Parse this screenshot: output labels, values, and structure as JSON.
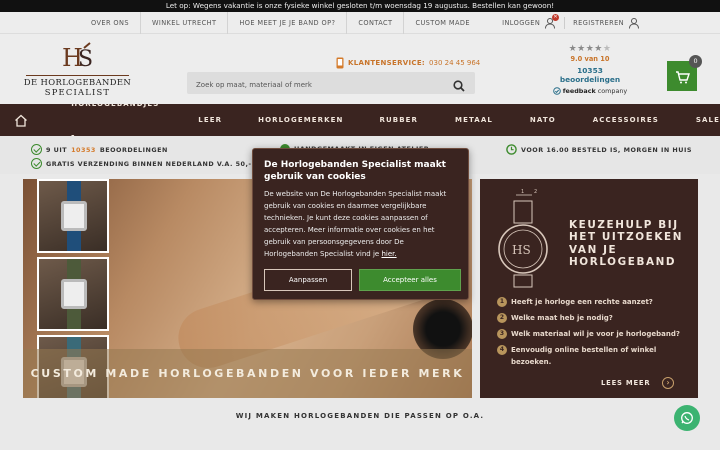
{
  "announcement": "Let op: Wegens vakantie is onze fysieke winkel gesloten t/m woensdag 19 augustus. Bestellen kan gewoon!",
  "topnav": [
    "OVER ONS",
    "WINKEL UTRECHT",
    "HOE MEET JE JE BAND OP?",
    "CONTACT",
    "CUSTOM MADE"
  ],
  "account": {
    "login": "INLOGGEN",
    "register": "REGISTREREN"
  },
  "logo": {
    "line1": "DE HORLOGEBANDEN",
    "line2": "SPECIALIST"
  },
  "search": {
    "placeholder": "Zoek op maat, materiaal of merk"
  },
  "service": {
    "label": "KLANTENSERVICE:",
    "phone": "030 24 45 964"
  },
  "reviews": {
    "stars": 4.5,
    "score": "9.0 van 10",
    "count": "10353 beoordelingen",
    "source_prefix": "feedback",
    "source_suffix": "company"
  },
  "cart": {
    "count": "0"
  },
  "mainnav": [
    "HORLOGEBANDJES",
    "LEER",
    "HORLOGEMERKEN",
    "RUBBER",
    "METAAL",
    "NATO",
    "ACCESSOIRES",
    "SALE"
  ],
  "usps": {
    "rating_prefix": "9 UIT",
    "rating_count": "10353",
    "rating_suffix": "BEOORDELINGEN",
    "shipping": "GRATIS VERZENDING BINNEN NEDERLAND V.A. 50,-",
    "middle": "HANDGEMAAKT IN EIGEN ATELIER",
    "delivery": "VOOR 16.00 BESTELD IS, MORGEN IN HUIS"
  },
  "hero": {
    "caption": "CUSTOM MADE HORLOGEBANDEN VOOR IEDER MERK"
  },
  "helper": {
    "title": "KEUZEHULP BIJ HET UITZOEKEN VAN JE HORLOGEBAND",
    "steps": [
      "Heeft je horloge een rechte aanzet?",
      "Welke maat heb je nodig?",
      "Welk materiaal wil je voor je horlogeband?",
      "Eenvoudig online bestellen of winkel bezoeken."
    ],
    "more": "LEES MEER"
  },
  "tagline": "WIJ MAKEN HORLOGEBANDEN DIE PASSEN OP O.A.",
  "cookie": {
    "title": "De Horlogebanden Specialist maakt gebruik van cookies",
    "body": "De website van De Horlogebanden Specialist maakt gebruik van cookies en daarmee vergelijkbare technieken. Je kunt deze cookies aanpassen of accepteren. Meer informatie over cookies en het gebruik van persoonsgegevens door De Horlogebanden Specialist vind je",
    "link": "hier.",
    "adjust": "Aanpassen",
    "accept": "Accepteer alles"
  },
  "colors": {
    "brand_brown": "#3a2420",
    "accent_orange": "#d47a2a",
    "green": "#3d8b2e"
  }
}
